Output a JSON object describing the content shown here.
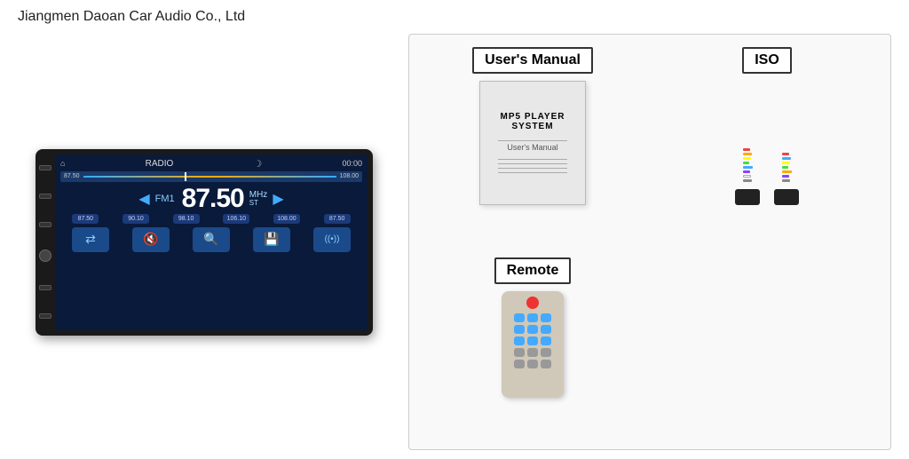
{
  "brand": "Jiangmen Daoan Car Audio Co., Ltd",
  "radio": {
    "mode": "RADIO",
    "time": "00:00",
    "freq_start": "87.50",
    "freq_end": "108.00",
    "fm_label": "FM1",
    "frequency": "87.50",
    "unit": "MHz",
    "stereo": "ST",
    "presets": [
      "87.50",
      "90.10",
      "98.10",
      "106.10",
      "108.00",
      "87.50"
    ],
    "actions": [
      "⇄",
      "🔇",
      "🔍",
      "💾",
      "((•))"
    ]
  },
  "accessories": {
    "manual": {
      "label": "User's Manual",
      "title": "MP5 PLAYER SYSTEM",
      "subtitle": "User's Manual"
    },
    "iso": {
      "label": "ISO"
    },
    "remote": {
      "label": "Remote"
    }
  }
}
